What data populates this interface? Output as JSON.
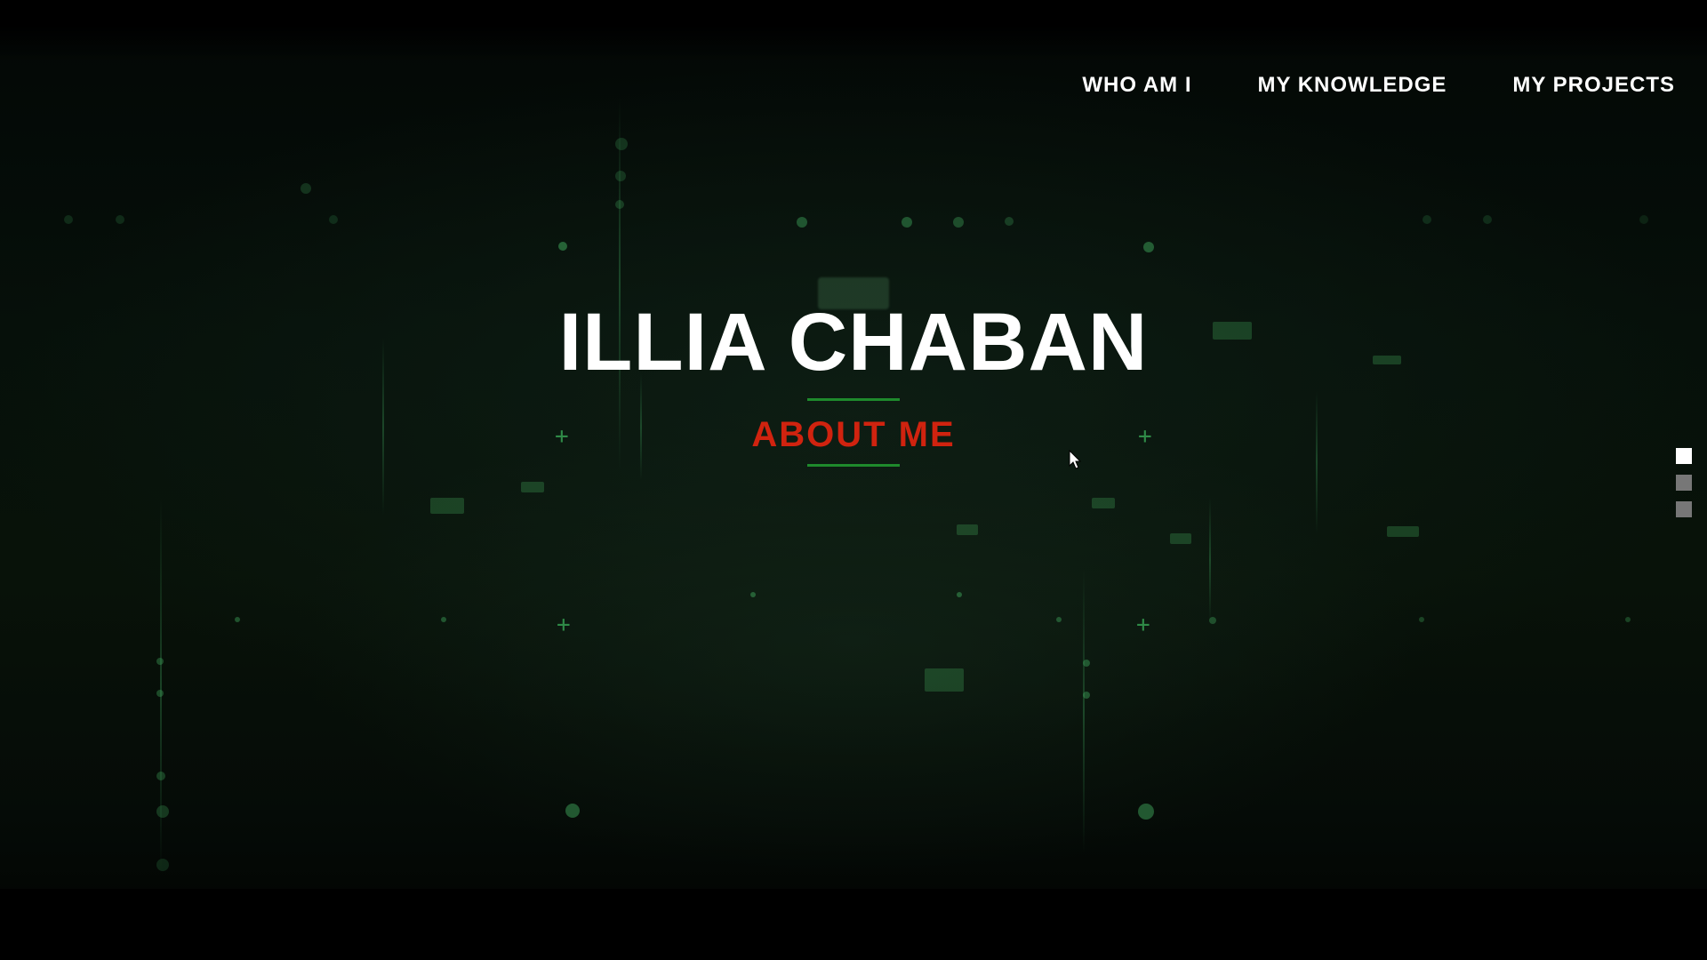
{
  "nav": {
    "items": [
      {
        "label": "WHO AM I"
      },
      {
        "label": "MY KNOWLEDGE"
      },
      {
        "label": "MY PROJECTS"
      }
    ]
  },
  "hero": {
    "title": "ILLIA CHABAN",
    "subtitle": "ABOUT ME"
  },
  "pager": {
    "count": 3,
    "active_index": 0
  },
  "colors": {
    "background": "#050b07",
    "title": "#ffffff",
    "subtitle": "#d0230f",
    "rule": "#1e8a2c",
    "pager_active": "#ffffff",
    "pager_inactive": "#777777"
  }
}
